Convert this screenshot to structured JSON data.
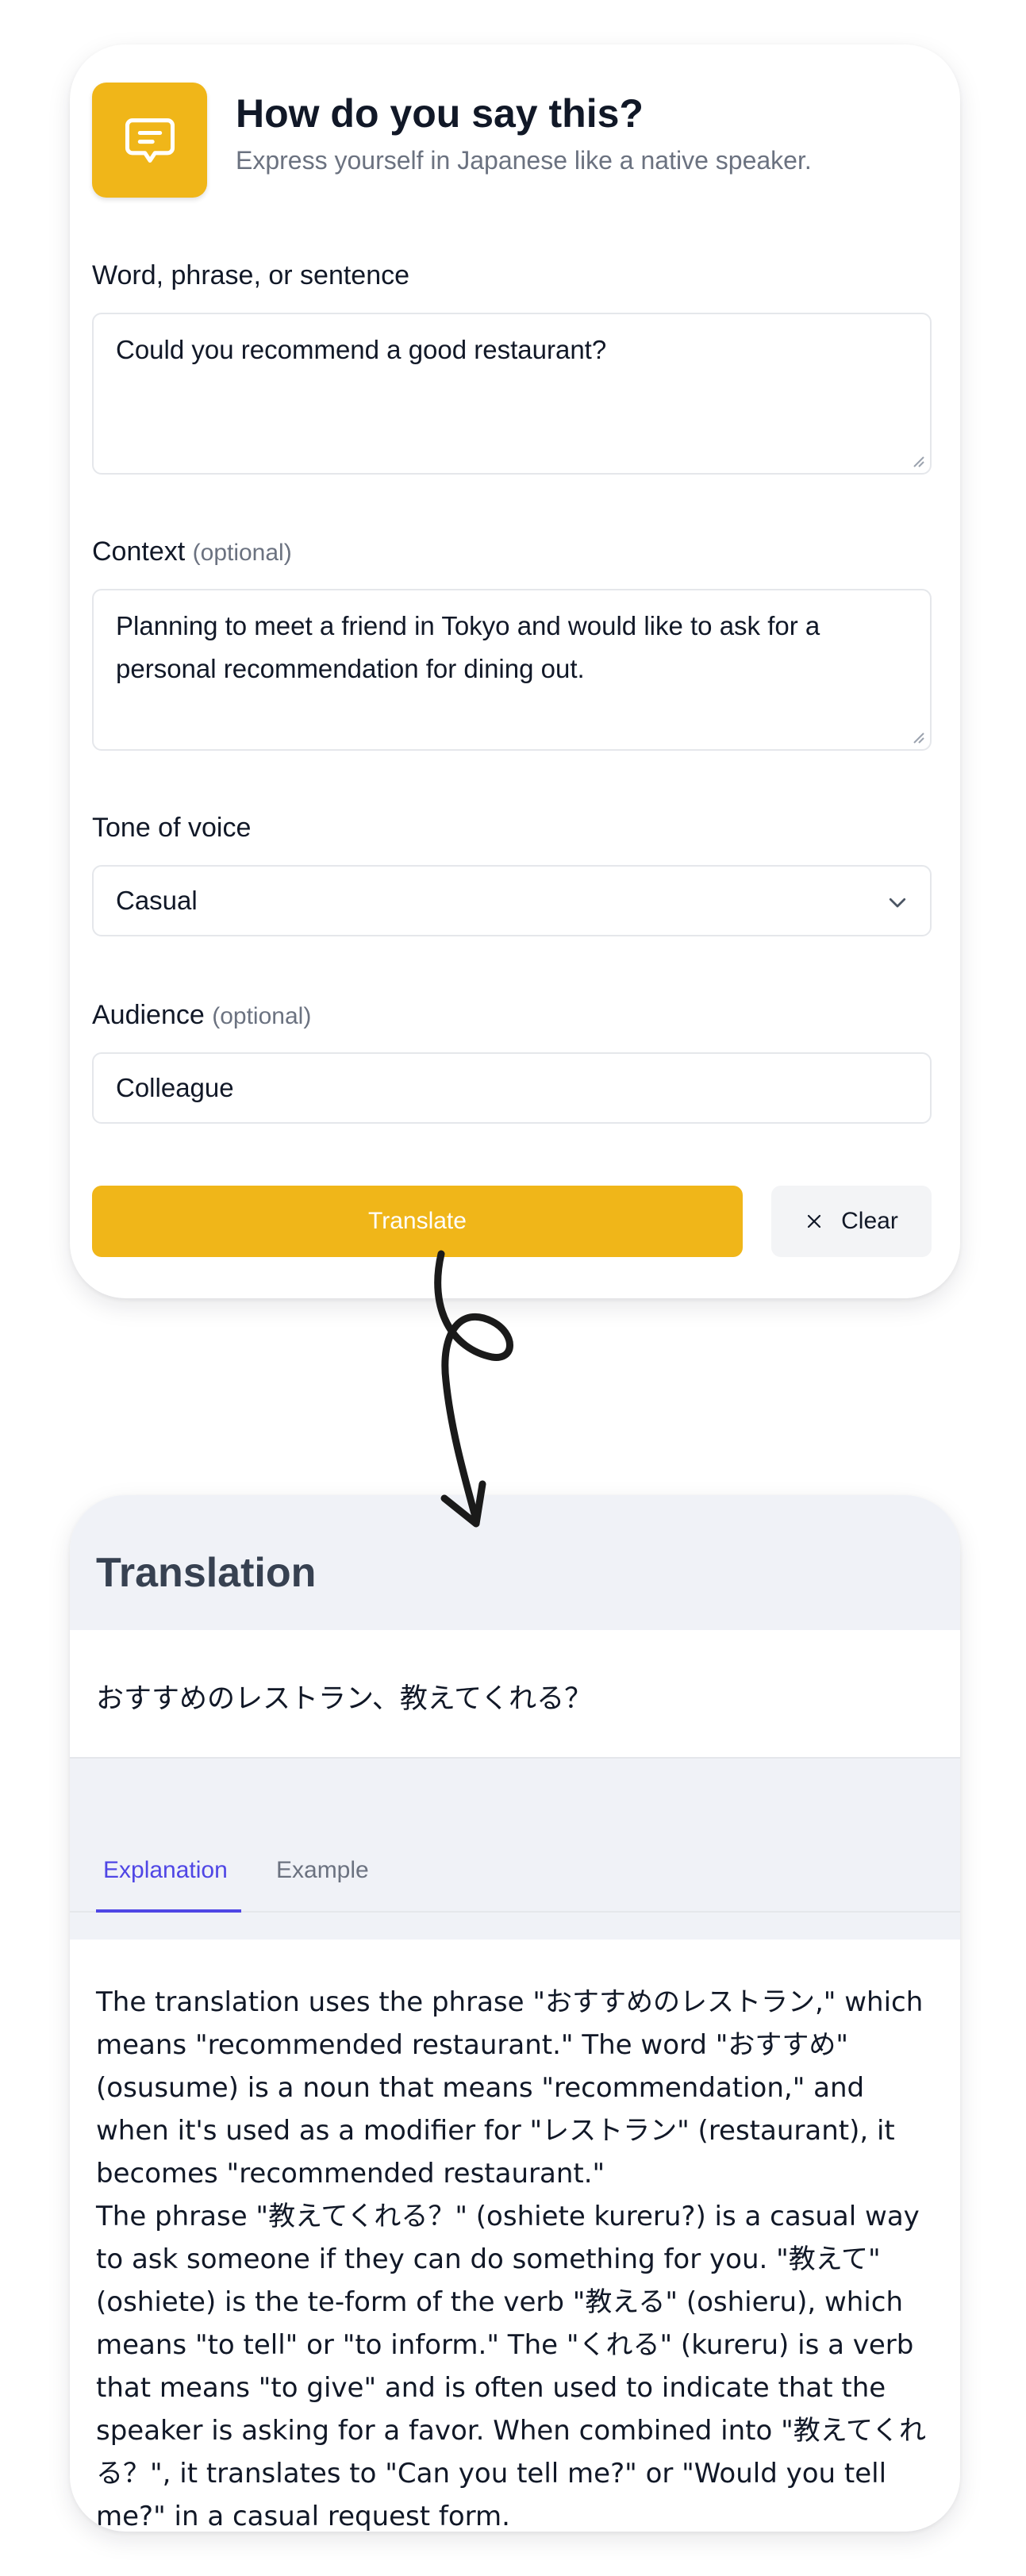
{
  "header": {
    "title": "How do you say this?",
    "subtitle": "Express yourself in Japanese like a native speaker.",
    "logo_icon": "chat-bubble-icon",
    "accent_color": "#f0b619"
  },
  "form": {
    "phrase": {
      "label": "Word, phrase, or sentence",
      "value": "Could you recommend a good restaurant?"
    },
    "context": {
      "label": "Context",
      "optional_note": "(optional)",
      "value": "Planning to meet a friend in Tokyo and would like to ask for a personal recommendation for dining out."
    },
    "tone": {
      "label": "Tone of voice",
      "selected": "Casual"
    },
    "audience": {
      "label": "Audience",
      "optional_note": "(optional)",
      "value": "Colleague"
    },
    "translate_label": "Translate",
    "clear_label": "Clear"
  },
  "result": {
    "title": "Translation",
    "translation": "おすすめのレストラン、教えてくれる？",
    "tabs": [
      {
        "label": "Explanation",
        "active": true
      },
      {
        "label": "Example",
        "active": false
      }
    ],
    "active_tab_color": "#4f46e5",
    "explanation": "The translation uses the phrase \"おすすめのレストラン,\" which means \"recommended restaurant.\" The word \"おすすめ\" (osusume) is a noun that means \"recommendation,\" and when it's used as a modifier for \"レストラン\" (restaurant), it becomes \"recommended restaurant.\"\nThe phrase \"教えてくれる？\" (oshiete kureru?) is a casual way to ask someone if they can do something for you. \"教えて\" (oshiete) is the te-form of the verb \"教える\" (oshieru), which means \"to tell\" or \"to inform.\" The \"くれる\" (kureru) is a verb that means \"to give\" and is often used to indicate that the speaker is asking for a favor. When combined into \"教えてくれる？\", it translates to \"Can you tell me?\" or \"Would you tell me?\" in a casual request form."
  }
}
